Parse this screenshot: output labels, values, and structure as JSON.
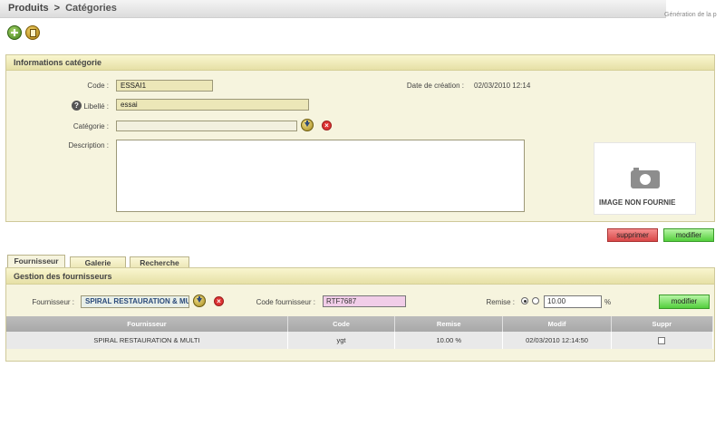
{
  "breadcrumb": {
    "root": "Produits",
    "separator": ">",
    "current": "Catégories"
  },
  "header_note": "Génération de la p",
  "info_panel": {
    "title": "Informations catégorie",
    "code_label": "Code :",
    "code_value": "ESSAI1",
    "date_label": "Date de création :",
    "date_value": "02/03/2010 12:14",
    "libelle_label": "Libellé :",
    "libelle_value": "essai",
    "categorie_label": "Catégorie :",
    "categorie_value": "",
    "description_label": "Description :",
    "image_text": "IMAGE NON FOURNIE"
  },
  "actions": {
    "delete_label": "supprimer",
    "modify_label": "modifier"
  },
  "tabs": [
    {
      "label": "Fournisseur",
      "active": true
    },
    {
      "label": "Galerie",
      "active": false
    },
    {
      "label": "Recherche",
      "active": false
    }
  ],
  "suppliers_panel": {
    "title": "Gestion des fournisseurs",
    "fournisseur_label": "Fournisseur :",
    "fournisseur_value": "SPIRAL RESTAURATION & MULTI",
    "code_fournisseur_label": "Code fournisseur :",
    "code_fournisseur_value": "RTF7687",
    "remise_label": "Remise :",
    "remise_value": "10.00",
    "remise_unit": "%",
    "modify_label": "modifier",
    "table": {
      "headers": [
        "Fournisseur",
        "Code",
        "Remise",
        "Modif",
        "Suppr"
      ],
      "rows": [
        {
          "fournisseur": "SPIRAL RESTAURATION & MULTI",
          "code": "ygt",
          "remise": "10.00 %",
          "modif": "02/03/2010 12:14:50",
          "suppr": false
        }
      ]
    }
  },
  "colors": {
    "panel_bg": "#f6f4de",
    "field_bg": "#ece7b8",
    "delete_red": "#d94848",
    "modify_green": "#53cf3c"
  }
}
